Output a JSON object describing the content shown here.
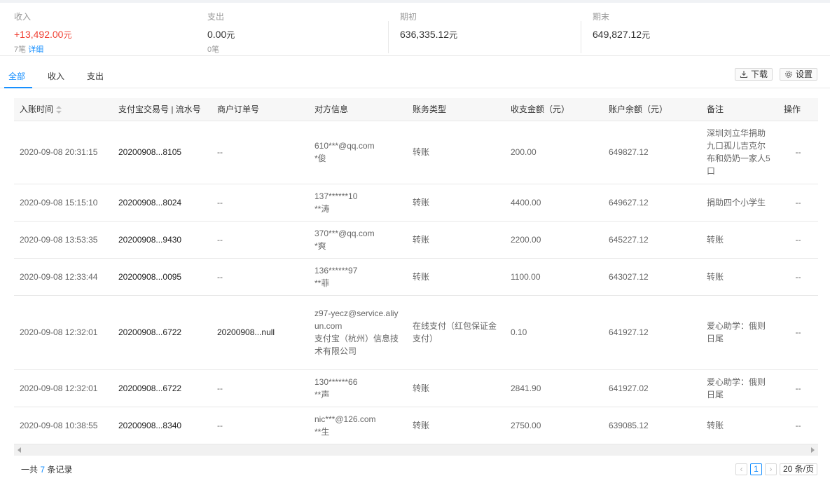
{
  "summary": {
    "income": {
      "label": "收入",
      "value": "+13,492.00",
      "unit": "元",
      "sub_count": "7笔",
      "sub_link": "详细"
    },
    "expense": {
      "label": "支出",
      "value": "0.00",
      "unit": "元",
      "sub_count": "0笔"
    },
    "opening": {
      "label": "期初",
      "value": "636,335.12",
      "unit": "元"
    },
    "closing": {
      "label": "期末",
      "value": "649,827.12",
      "unit": "元"
    }
  },
  "tabs": [
    {
      "label": "全部",
      "active": true
    },
    {
      "label": "收入",
      "active": false
    },
    {
      "label": "支出",
      "active": false
    }
  ],
  "toolbar": {
    "download_label": "下载",
    "settings_label": "设置"
  },
  "table": {
    "columns": [
      "入账时间",
      "支付宝交易号 | 流水号",
      "商户订单号",
      "对方信息",
      "账务类型",
      "收支金额（元）",
      "账户余额（元）",
      "备注",
      "操作"
    ],
    "rows": [
      {
        "time": "2020-09-08 20:31:15",
        "trade_no": "20200908...8105",
        "order_no": "--",
        "cp1": "610***@qq.com",
        "cp2": "*俊",
        "type": "转账",
        "amount": "200.00",
        "balance": "649827.12",
        "remark": "深圳刘立华捐助九口孤儿吉克尔布和奶奶一家人5口",
        "op": "--"
      },
      {
        "time": "2020-09-08 15:15:10",
        "trade_no": "20200908...8024",
        "order_no": "--",
        "cp1": "137******10",
        "cp2": "**涛",
        "type": "转账",
        "amount": "4400.00",
        "balance": "649627.12",
        "remark": "捐助四个小学生",
        "op": "--"
      },
      {
        "time": "2020-09-08 13:53:35",
        "trade_no": "20200908...9430",
        "order_no": "--",
        "cp1": "370***@qq.com",
        "cp2": "*爽",
        "type": "转账",
        "amount": "2200.00",
        "balance": "645227.12",
        "remark": "转账",
        "op": "--"
      },
      {
        "time": "2020-09-08 12:33:44",
        "trade_no": "20200908...0095",
        "order_no": "--",
        "cp1": "136******97",
        "cp2": "**菲",
        "type": "转账",
        "amount": "1100.00",
        "balance": "643027.12",
        "remark": "转账",
        "op": "--"
      },
      {
        "time": "2020-09-08 12:32:01",
        "trade_no": "20200908...6722",
        "order_no": "20200908...null",
        "cp1": "z97-yecz@service.aliyun.com",
        "cp2": "支付宝（杭州）信息技术有限公司",
        "type": "在线支付（红包保证金支付）",
        "amount": "0.10",
        "balance": "641927.12",
        "remark": "爱心助学：俄则日尾",
        "op": "--"
      },
      {
        "time": "2020-09-08 12:32:01",
        "trade_no": "20200908...6722",
        "order_no": "--",
        "cp1": "130******66",
        "cp2": "**声",
        "type": "转账",
        "amount": "2841.90",
        "balance": "641927.02",
        "remark": "爱心助学：俄则日尾",
        "op": "--"
      },
      {
        "time": "2020-09-08 10:38:55",
        "trade_no": "20200908...8340",
        "order_no": "--",
        "cp1": "nic***@126.com",
        "cp2": "**生",
        "type": "转账",
        "amount": "2750.00",
        "balance": "639085.12",
        "remark": "转账",
        "op": "--"
      }
    ]
  },
  "footer": {
    "total_prefix": "一共",
    "total_count": "7",
    "total_suffix": "条记录",
    "current_page": "1",
    "page_size": "20 条/页"
  }
}
